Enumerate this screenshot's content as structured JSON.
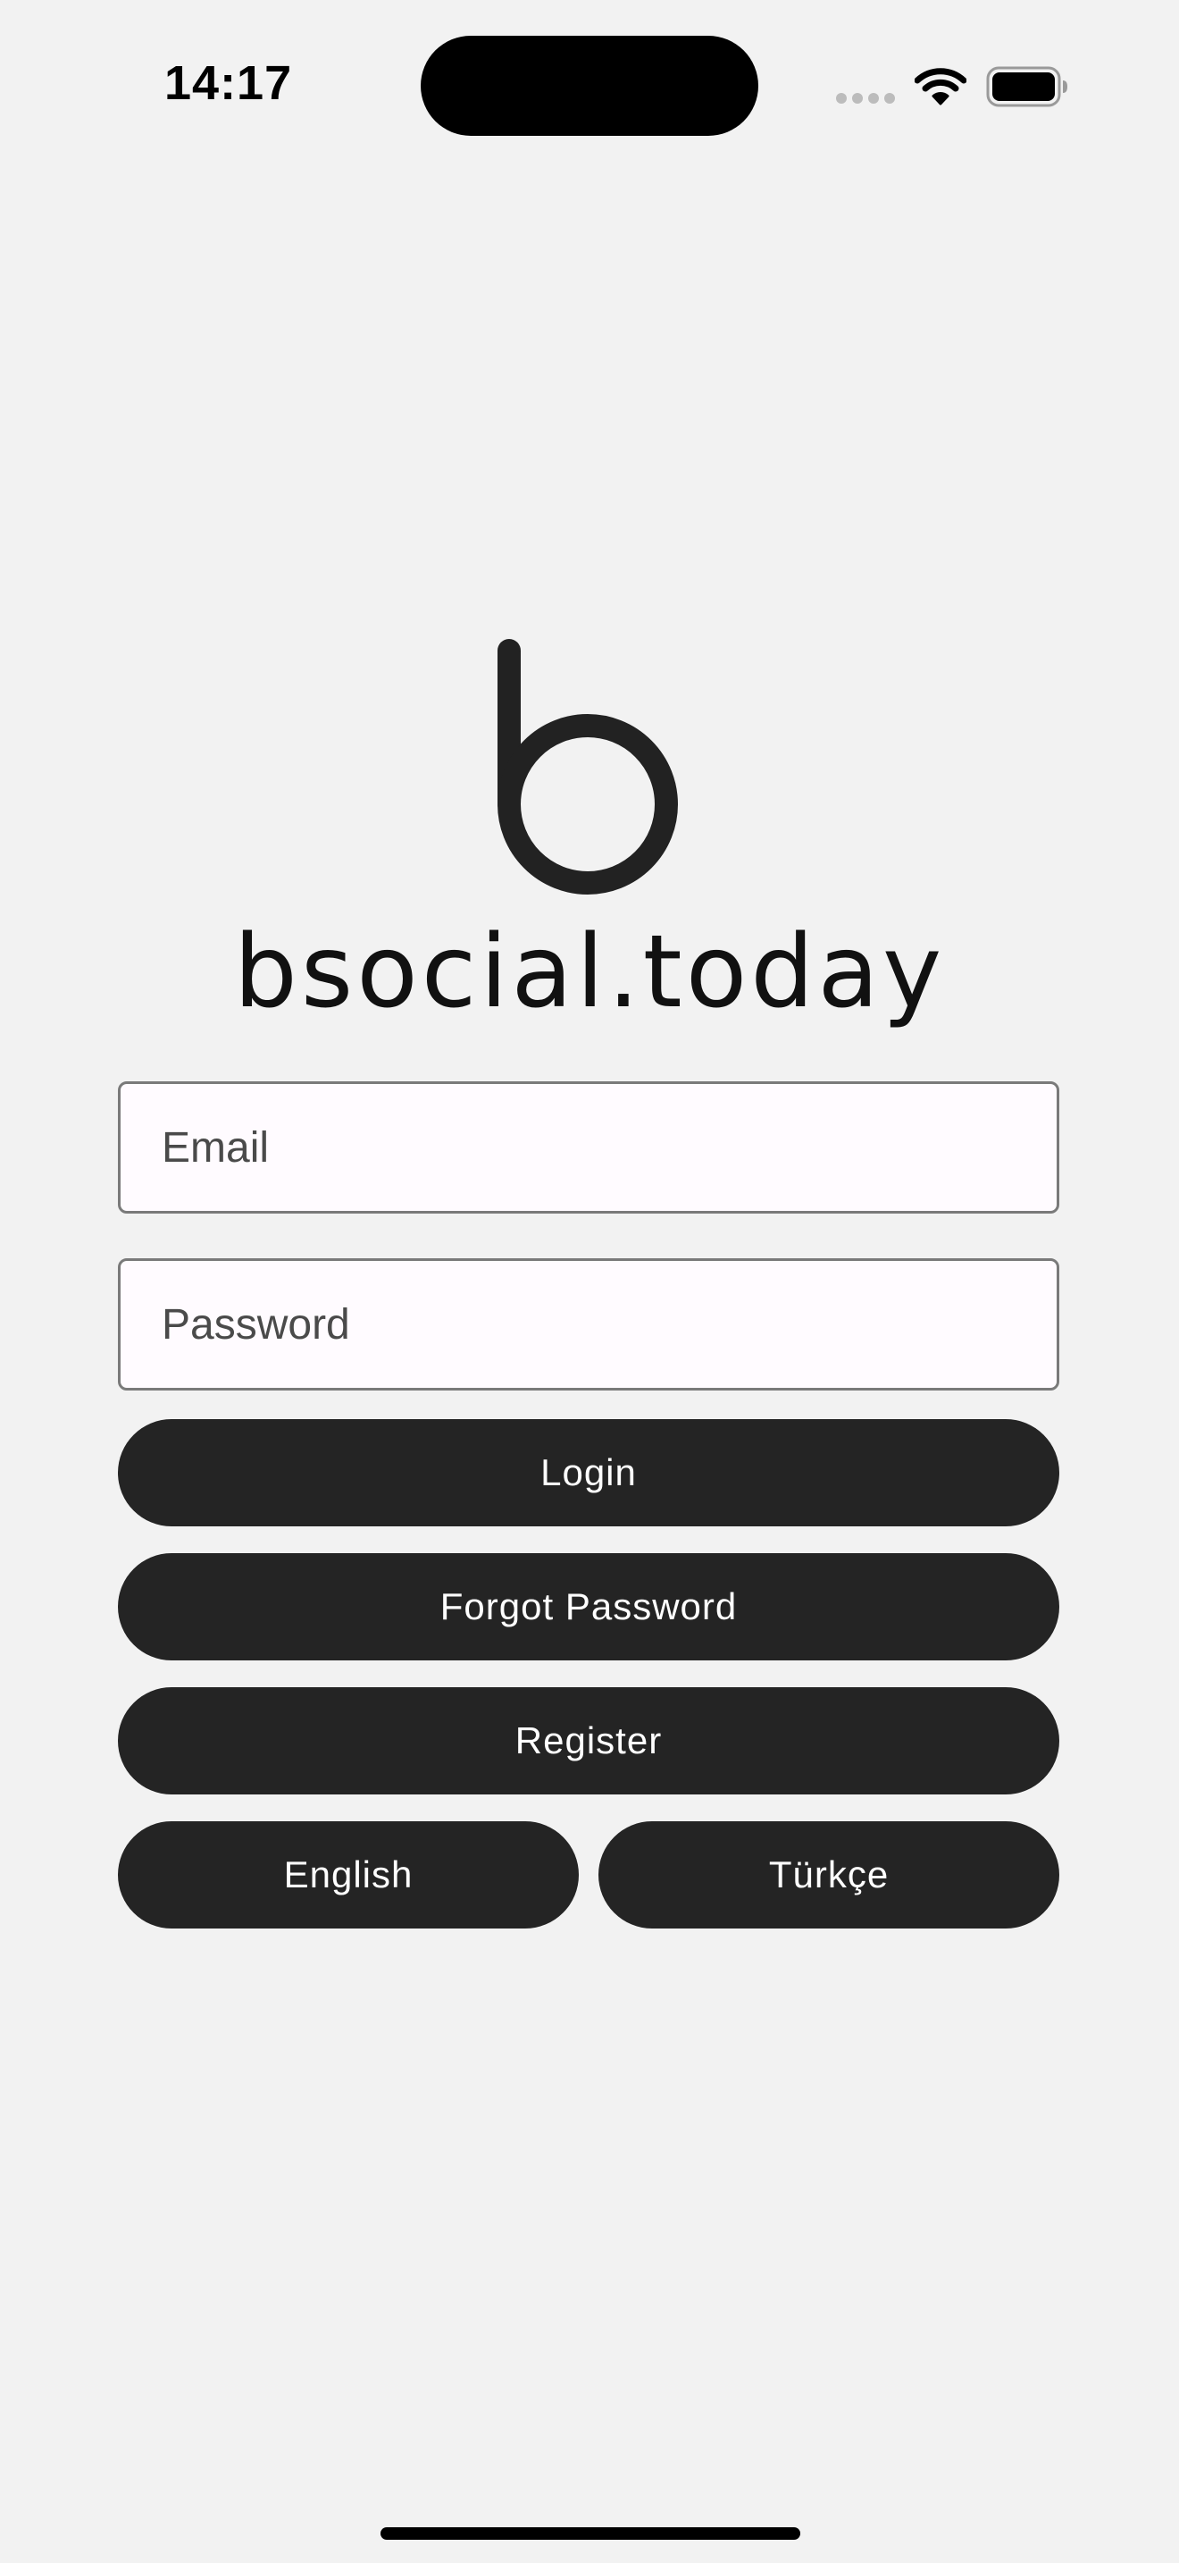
{
  "status_bar": {
    "time": "14:17"
  },
  "logo": {
    "wordmark": "bsocial.today"
  },
  "form": {
    "email_placeholder": "Email",
    "password_placeholder": "Password"
  },
  "buttons": {
    "login": "Login",
    "forgot_password": "Forgot Password",
    "register": "Register"
  },
  "language": {
    "english": "English",
    "turkish": "Türkçe"
  },
  "colors": {
    "background": "#f2f2f2",
    "button": "#242424",
    "button_text": "#ffffff",
    "field_background": "#fffbff",
    "field_border": "#7a7a7a"
  },
  "icons": [
    "cellular-signal-icon",
    "wifi-icon",
    "battery-icon"
  ]
}
